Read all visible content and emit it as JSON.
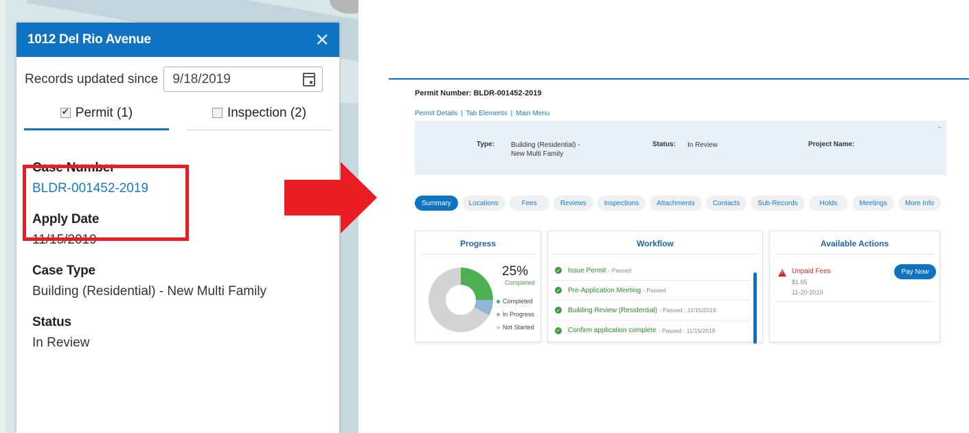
{
  "popup": {
    "title": "1012 Del Rio Avenue",
    "close_icon": "✕",
    "records_since_label": "Records updated since",
    "records_since_value": "9/18/2019",
    "tabs": [
      {
        "label": "Permit (1)",
        "checked": true
      },
      {
        "label": "Inspection (2)",
        "checked": false
      }
    ],
    "fields": [
      {
        "label": "Case Number",
        "value": "BLDR-001452-2019"
      },
      {
        "label": "Apply Date",
        "value": "11/15/2019"
      },
      {
        "label": "Case Type",
        "value": "Building (Residential) - New Multi Family"
      },
      {
        "label": "Status",
        "value": "In Review"
      }
    ]
  },
  "permit": {
    "number_line": "Permit Number: BLDR-001452-2019",
    "links": [
      "Permit Details",
      "Tab Elements",
      "Main Menu"
    ],
    "link_separator": "|",
    "chevron": "ˇ",
    "info": {
      "type_label": "Type:",
      "type_value_line1": "Building (Residential) -",
      "type_value_line2": "New Multi Family",
      "status_label": "Status:",
      "status_value": "In Review",
      "project_label": "Project Name:"
    },
    "tabs": [
      "Summary",
      "Locations",
      "Fees",
      "Reviews",
      "Inspections",
      "Attachments",
      "Contacts",
      "Sub-Records",
      "Holds",
      "Meetings",
      "More Info"
    ],
    "progress": {
      "title": "Progress",
      "percent": "25%",
      "percent_label": "Completed",
      "legend": [
        "Completed",
        "In Progress",
        "Not Started"
      ],
      "fractions": {
        "completed": 0.25,
        "in_progress": 0.08,
        "not_started": 0.67
      }
    },
    "workflow": {
      "title": "Workflow",
      "items": [
        {
          "name": "Issue Permit",
          "status": "- Passed"
        },
        {
          "name": "Pre-Application Meeting",
          "status": "- Passed"
        },
        {
          "name": "Building Review (Residential)",
          "status": "- Passed : 11/15/2019"
        },
        {
          "name": "Confirm application complete",
          "status": "- Passed : 11/15/2019"
        }
      ]
    },
    "actions": {
      "title": "Available Actions",
      "item_title": "Unpaid Fees",
      "amount": "$1.65",
      "date": "11-20-2019",
      "button": "Pay Now"
    }
  },
  "colors": {
    "primary": "#0f73c4",
    "link": "#1a7ac2",
    "highlight": "#ea1c24",
    "completed": "#4caf50",
    "in_progress": "#8fb6d6",
    "not_started": "#d3d3d3"
  }
}
